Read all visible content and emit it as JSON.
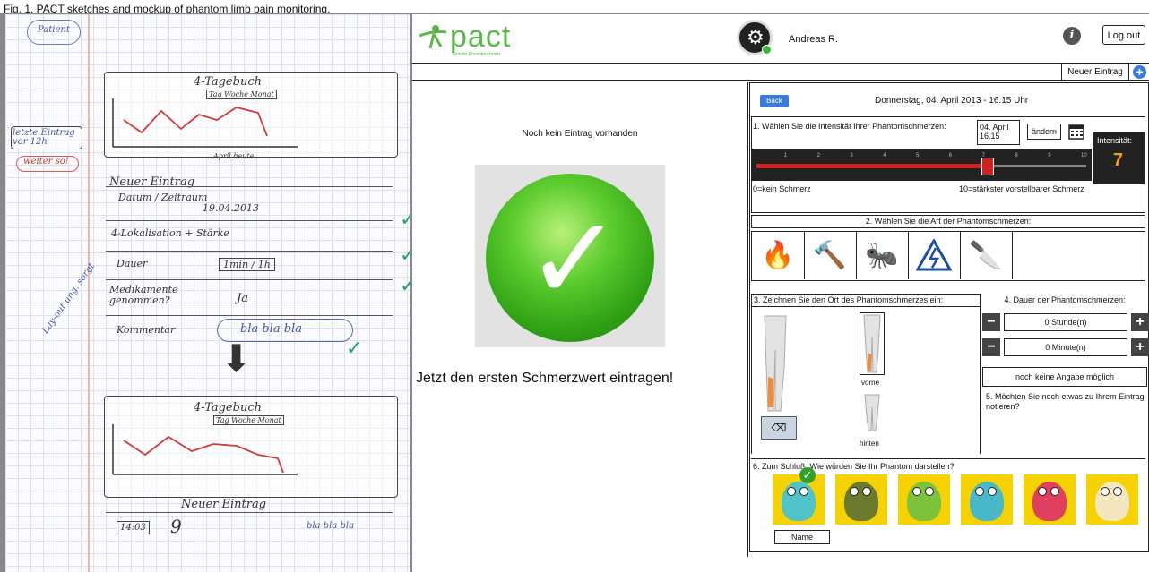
{
  "caption": "Fig. 1. PACT sketches and mockup of phantom limb pain monitoring.",
  "sketch": {
    "patient_tag": "Patient",
    "last_entry_tag": "letzte Eintrag vor 12h",
    "next_tag": "weiter so!",
    "layout_tag": "Lay-out ung. sorgt",
    "title": "4-Tagebuch",
    "tabs": "Tag  Woche  Monat",
    "chart_x": "April  heute",
    "new_entry": "Neuer Eintrag",
    "rows": [
      "Datum / Zeitraum",
      "4-Lokalisation + Stärke",
      "Dauer",
      "Medikamente genommen?",
      "Kommentar"
    ],
    "row_values": [
      "19.04.2013",
      "",
      "1min / 1h",
      "Ja",
      "bla bla bla"
    ],
    "title2": "4-Tagebuch",
    "new_entry2": "Neuer Eintrag",
    "row2_time": "14:03",
    "row2_comment": "bla bla bla"
  },
  "app": {
    "logo": "pact",
    "logo_sub": "Tabletts Prosiotpochnerz",
    "username": "Andreas R.",
    "info_icon": "info-icon",
    "logout": "Log out",
    "new_entry": "Neuer Eintrag",
    "no_entry": "Noch kein Eintrag vorhanden",
    "cta": "Jetzt den ersten Schmerzwert eintragen!",
    "back": "Back",
    "date_header": "Donnerstag, 04. April 2013 - 16.15 Uhr",
    "q1": "1. Wählen Sie die Intensität Ihrer Phantomschmerzen:",
    "date_box_line1": "04. April",
    "date_box_line2": "16.15",
    "change": "ändern",
    "slider_value": 7,
    "slider_max": 10,
    "slider_ticks": [
      "1",
      "2",
      "3",
      "4",
      "5",
      "6",
      "7",
      "8",
      "9",
      "10"
    ],
    "scale_low": "0=kein Schmerz",
    "scale_high": "10=stärkster vorstellbarer Schmerz",
    "intensity_label": "Intensität:",
    "intensity_value": "7",
    "q2": "2. Wählen Sie die Art der Phantomschmerzen:",
    "pain_types": [
      "fire",
      "hammer",
      "ants",
      "electric",
      "knife"
    ],
    "q3": "3. Zeichnen Sie den Ort des Phantomschmerzes ein:",
    "front": "vorne",
    "back_view": "hinten",
    "q4": "4. Dauer der Phantomschmerzen:",
    "hours": "0 Stunde(n)",
    "minutes": "0 Minute(n)",
    "no_info": "noch keine Angabe möglich",
    "q5": "5. Möchten Sie noch etwas zu Ihrem Eintrag notieren?",
    "q6": "6. Zum Schluß: Wie würden Sie Ihr Phantom darstellen?",
    "name_btn": "Name",
    "monsters": [
      {
        "color": "#4fc3c8"
      },
      {
        "color": "#6b7a2e"
      },
      {
        "color": "#7cc23a"
      },
      {
        "color": "#49b8c8"
      },
      {
        "color": "#e04060"
      },
      {
        "color": "#f3e6c0"
      }
    ]
  }
}
